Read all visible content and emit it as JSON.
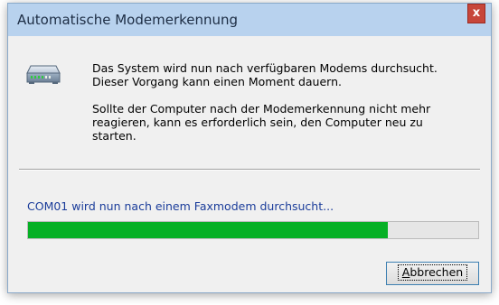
{
  "window": {
    "title": "Automatische Modemerkennung",
    "close_label": "x"
  },
  "message": {
    "line1": "Das System wird nun nach verfügbaren Modems durchsucht.",
    "line2": "Dieser Vorgang kann einen Moment dauern.",
    "para2_line1": "Sollte der Computer nach der Modemerkennung nicht mehr",
    "para2_line2": "reagieren, kann es erforderlich sein, den Computer neu zu",
    "para2_line3": "starten."
  },
  "status": {
    "text": "COM01 wird nun nach einem Faxmodem durchsucht...",
    "progress_fraction": 0.8
  },
  "buttons": {
    "cancel_mnemonic": "A",
    "cancel_rest": "bbrechen"
  },
  "icons": {
    "modem": "modem-icon",
    "close": "close-icon"
  },
  "colors": {
    "progress_fill": "#06b025",
    "status_text": "#1a3c9a",
    "titlebar": "#b8d2ee",
    "close_button": "#c7463a"
  }
}
